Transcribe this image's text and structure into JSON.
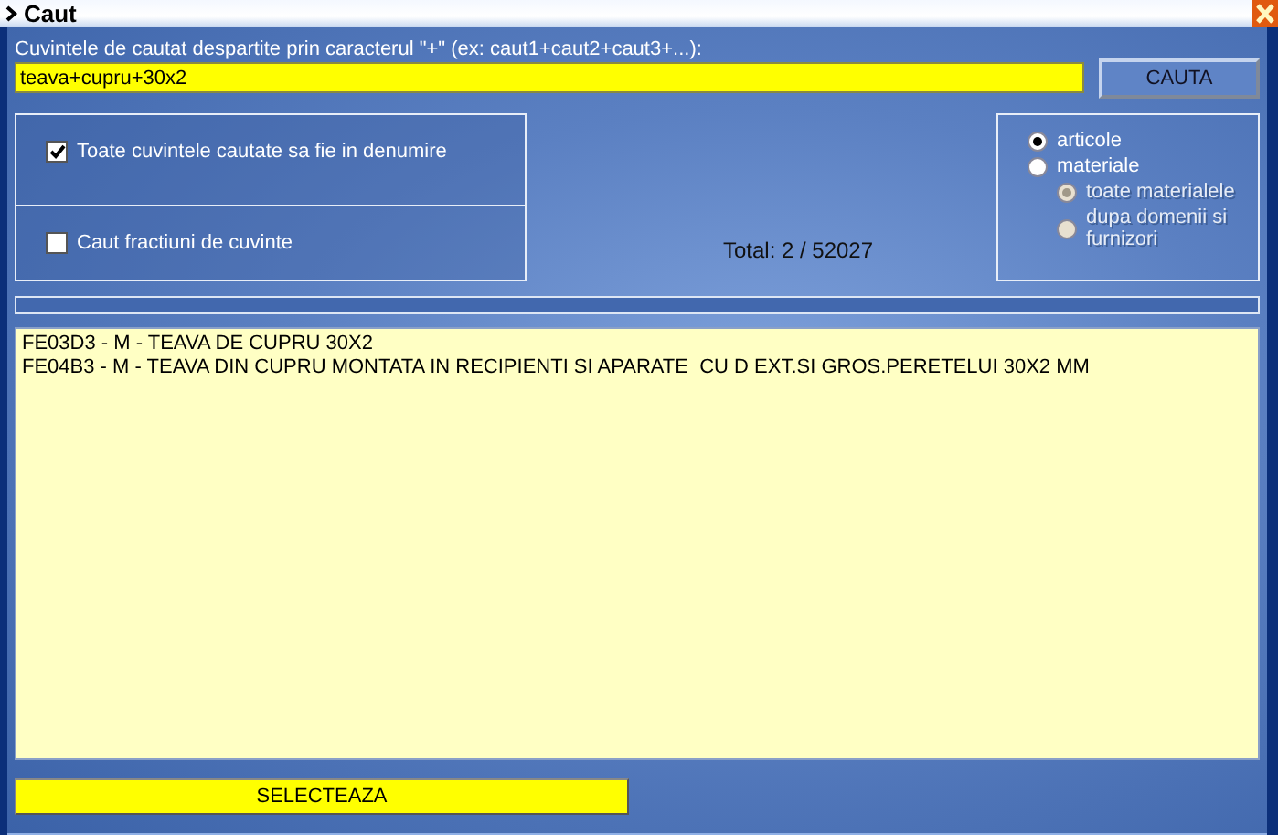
{
  "window": {
    "title": "Caut"
  },
  "search": {
    "label": "Cuvintele de cautat despartite prin caracterul \"+\" (ex: caut1+caut2+caut3+...):",
    "value": "teava+cupru+30x2",
    "button": "CAUTA"
  },
  "options": [
    {
      "label": "Toate cuvintele cautate sa fie in denumire",
      "checked": true
    },
    {
      "label": "Caut fractiuni de cuvinte",
      "checked": false
    }
  ],
  "total": "Total: 2 / 52027",
  "progress": {
    "level": 0
  },
  "scope": [
    {
      "label": "articole",
      "selected": true,
      "disabled": false
    },
    {
      "label": "materiale",
      "selected": false,
      "disabled": false,
      "children": [
        {
          "label": "toate materialele",
          "selected": true,
          "disabled": true
        },
        {
          "label": "dupa domenii si furnizori",
          "selected": false,
          "disabled": true
        }
      ]
    }
  ],
  "results": [
    "FE03D3 - M - TEAVA DE CUPRU 30X2",
    "FE04B3 - M - TEAVA DIN CUPRU MONTATA IN RECIPIENTI SI APARATE  CU D EXT.SI GROS.PERETELUI 30X2 MM"
  ],
  "select_button": "SELECTEAZA"
}
